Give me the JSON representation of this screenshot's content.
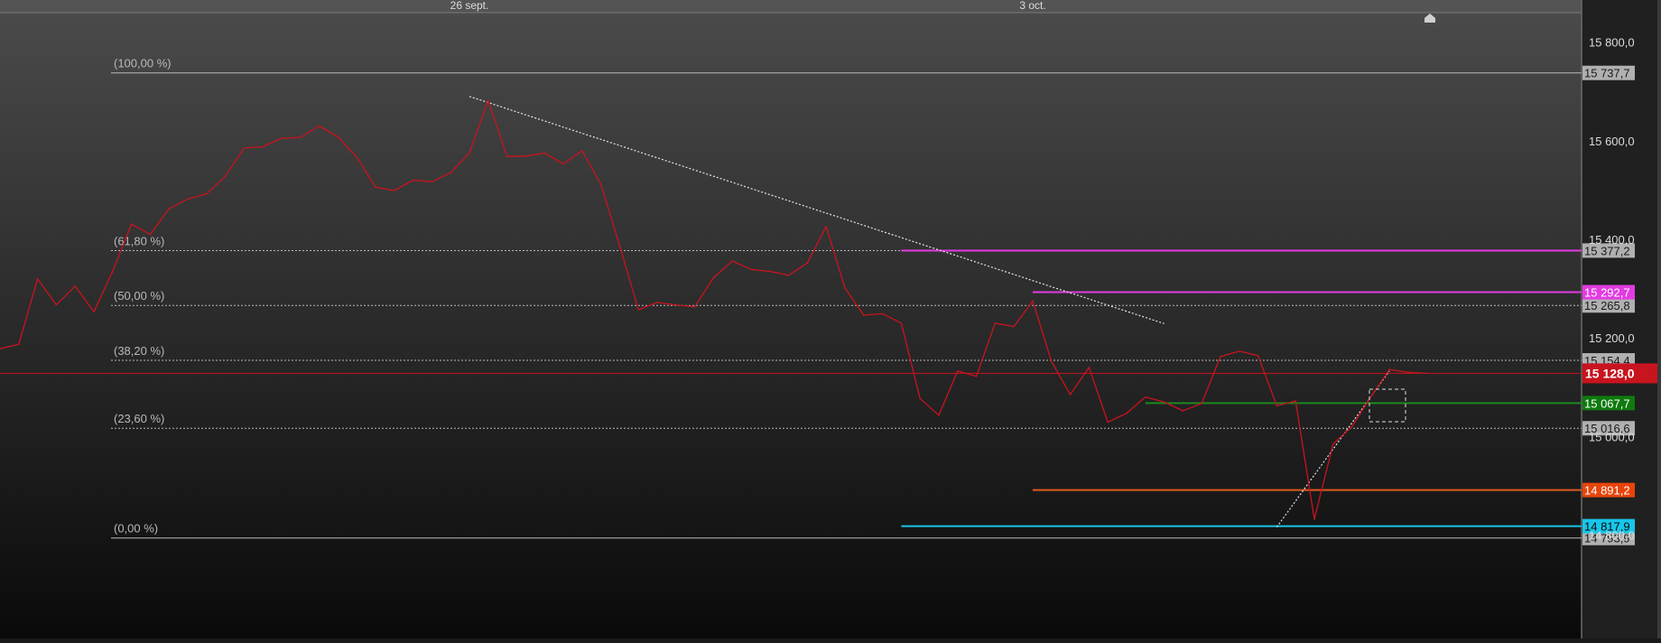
{
  "chart_data": {
    "type": "line",
    "x_labels": [
      {
        "label": "26 sept.",
        "index": 25
      },
      {
        "label": "3 oct.",
        "index": 55
      }
    ],
    "yaxis_ticks": [
      15800,
      15600,
      15400,
      15200,
      15000,
      14800
    ],
    "ylim": [
      14590,
      15860
    ],
    "xlim": [
      0,
      83
    ],
    "series": [
      {
        "values": [
          15178,
          15187,
          15320,
          15267,
          15305,
          15253,
          15335,
          15431,
          15410,
          15462,
          15482,
          15492,
          15528,
          15585,
          15588,
          15605,
          15607,
          15630,
          15608,
          15567,
          15506,
          15499,
          15520,
          15517,
          15535,
          15575,
          15682,
          15568,
          15569,
          15575,
          15553,
          15580,
          15512,
          15387,
          15257,
          15272,
          15267,
          15263,
          15322,
          15356,
          15339,
          15335,
          15327,
          15352,
          15426,
          15301,
          15246,
          15249,
          15230,
          15077,
          15043,
          15133,
          15122,
          15230,
          15223,
          15275,
          15152,
          15085,
          15140,
          15029,
          15047,
          15080,
          15070,
          15052,
          15067,
          15162,
          15173,
          15164,
          15062,
          15072,
          14832,
          14985,
          15020,
          15080,
          15136,
          15130,
          15128
        ]
      }
    ],
    "fib_levels": [
      {
        "label": "(100,00 %)",
        "value": 15737.7,
        "value_label": "15 737,7"
      },
      {
        "label": "(61,80 %)",
        "value": 15377.2,
        "value_label": "15 377,2"
      },
      {
        "label": "(50,00 %)",
        "value": 15265.8,
        "value_label": "15 265,8"
      },
      {
        "label": "(38,20 %)",
        "value": 15154.4,
        "value_label": "15 154,4"
      },
      {
        "label": "(23,60 %)",
        "value": 15016.6,
        "value_label": "15 016,6"
      },
      {
        "label": "(0,00 %)",
        "value": 14793.9,
        "value_label": "14 793,9"
      }
    ],
    "hlines": [
      {
        "value": 15377.2,
        "color": "#e23be2",
        "x_start": 48
      },
      {
        "value": 15292.7,
        "color": "#e23be2",
        "x_start": 55,
        "label": "15 292,7",
        "label_bg": "#e23be2",
        "label_color": "#ffffff"
      },
      {
        "value": 15067.7,
        "color": "#1c8a1c",
        "x_start": 61,
        "label": "15 067,7",
        "label_bg": "#0f7a0f",
        "label_color": "#ffffff"
      },
      {
        "value": 14891.2,
        "color": "#e05a1e",
        "x_start": 55,
        "label": "14 891,2",
        "label_bg": "#e8440a",
        "label_color": "#ffffff"
      },
      {
        "value": 14817.9,
        "color": "#19c4e6",
        "x_start": 48,
        "label": "14 817,9",
        "label_bg": "#18c6ea",
        "label_color": "#0a0a0a"
      }
    ],
    "last_price": {
      "value": 15128.0,
      "label": "15 128,0",
      "color": "#c8141e"
    },
    "trendlines": [
      {
        "x1": 25,
        "y1": 15690,
        "x2": 62,
        "y2": 15229
      },
      {
        "x1": 68,
        "y1": 14816,
        "x2": 74,
        "y2": 15133
      }
    ],
    "colors": {
      "price": "#c8141e",
      "fib": "#b9b9b9",
      "axis_text": "#dcdcdc"
    }
  }
}
